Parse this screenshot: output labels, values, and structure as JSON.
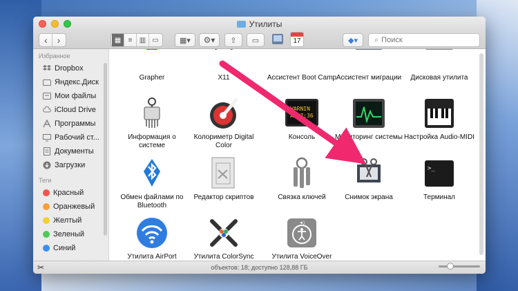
{
  "window": {
    "title": "Утилиты"
  },
  "toolbar": {
    "back_label": "‹",
    "forward_label": "›",
    "calendar_day": "17",
    "search_placeholder": "Поиск"
  },
  "sidebar": {
    "favorites_heading": "Избранное",
    "favorites": [
      {
        "label": "Dropbox",
        "icon": "dropbox-icon"
      },
      {
        "label": "Яндекс.Диск",
        "icon": "folder-icon"
      },
      {
        "label": "Мои файлы",
        "icon": "all-files-icon"
      },
      {
        "label": "iCloud Drive",
        "icon": "cloud-icon"
      },
      {
        "label": "Программы",
        "icon": "applications-icon"
      },
      {
        "label": "Рабочий ст...",
        "icon": "desktop-icon"
      },
      {
        "label": "Документы",
        "icon": "documents-icon"
      },
      {
        "label": "Загрузки",
        "icon": "downloads-icon"
      }
    ],
    "tags_heading": "Теги",
    "tags": [
      {
        "label": "Красный",
        "color": "#f2544d"
      },
      {
        "label": "Оранжевый",
        "color": "#f6a03a"
      },
      {
        "label": "Желтый",
        "color": "#f3cf35"
      },
      {
        "label": "Зеленый",
        "color": "#4fc85a"
      },
      {
        "label": "Синий",
        "color": "#3a8ef0"
      }
    ]
  },
  "items": [
    {
      "label": "Grapher",
      "icon": "grapher-icon"
    },
    {
      "label": "X11",
      "icon": "x11-icon"
    },
    {
      "label": "Ассистент Boot Camp",
      "icon": "bootcamp-icon"
    },
    {
      "label": "Ассистент миграции",
      "icon": "migration-icon"
    },
    {
      "label": "Дисковая утилита",
      "icon": "disk-utility-icon"
    },
    {
      "label": "Информация о системе",
      "icon": "system-information-icon"
    },
    {
      "label": "Колориметр Digital Color",
      "icon": "digital-color-meter-icon"
    },
    {
      "label": "Консоль",
      "icon": "console-icon",
      "console_text_1": "WARNIN",
      "console_text_2": "AY 7:36"
    },
    {
      "label": "Мониторинг системы",
      "icon": "activity-monitor-icon"
    },
    {
      "label": "Настройка Audio-MIDI",
      "icon": "audio-midi-icon"
    },
    {
      "label": "Обмен файлами по Bluetooth",
      "icon": "bluetooth-icon"
    },
    {
      "label": "Редактор скриптов",
      "icon": "script-editor-icon"
    },
    {
      "label": "Связка ключей",
      "icon": "keychain-icon"
    },
    {
      "label": "Снимок экрана",
      "icon": "screenshot-icon"
    },
    {
      "label": "Терминал",
      "icon": "terminal-icon",
      "terminal_text": ">_"
    },
    {
      "label": "Утилита AirPort",
      "icon": "airport-icon"
    },
    {
      "label": "Утилита ColorSync",
      "icon": "colorsync-icon"
    },
    {
      "label": "Утилита VoiceOver",
      "icon": "voiceover-icon"
    }
  ],
  "status": {
    "text": "объектов: 18; доступно 128,88 ГБ"
  },
  "colors": {
    "arrow": "#f0286e",
    "accent": "#2f7de1"
  }
}
